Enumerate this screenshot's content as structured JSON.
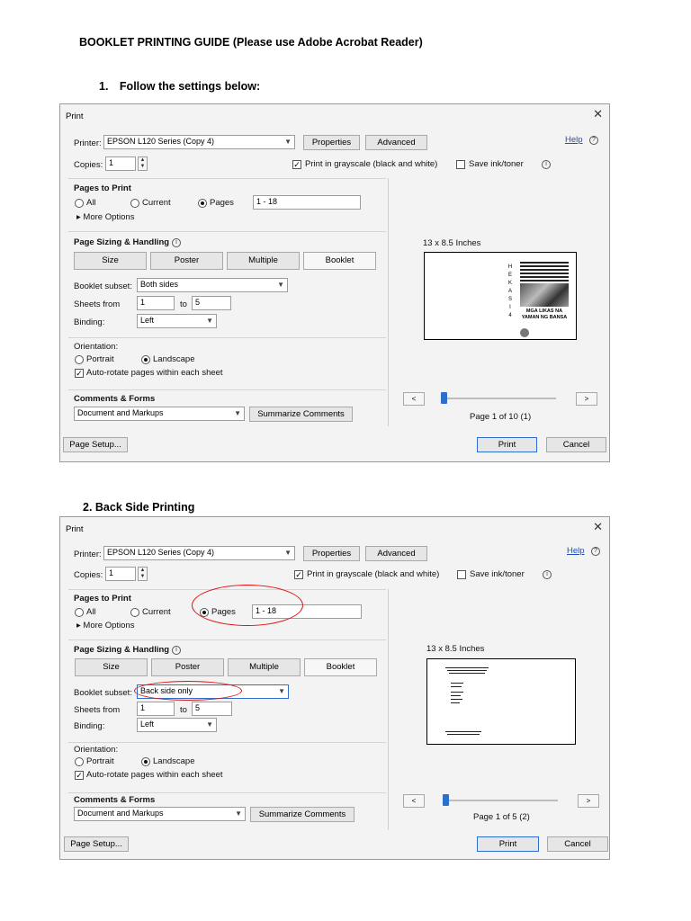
{
  "doc": {
    "title": "BOOKLET PRINTING GUIDE (Please use Adobe Acrobat Reader)",
    "step1": "1. Follow the settings below:",
    "step2": "2. Back Side Printing"
  },
  "dialogs": [
    {
      "title": "Print",
      "printer_label": "Printer:",
      "printer_value": "EPSON L120 Series (Copy 4)",
      "properties": "Properties",
      "advanced": "Advanced",
      "help": "Help",
      "copies_label": "Copies:",
      "copies_value": "1",
      "grayscale": "Print in grayscale (black and white)",
      "save_ink": "Save ink/toner",
      "pages_to_print": "Pages to Print",
      "all": "All",
      "current": "Current",
      "pages": "Pages",
      "pages_value": "1 - 18",
      "more_options": "More Options",
      "sizing": "Page Sizing & Handling",
      "size": "Size",
      "poster": "Poster",
      "multiple": "Multiple",
      "booklet": "Booklet",
      "booklet_subset_label": "Booklet subset:",
      "booklet_subset_value": "Both sides",
      "sheets_from_label": "Sheets from",
      "sheets_from_value": "1",
      "to_label": "to",
      "sheets_to_value": "5",
      "binding_label": "Binding:",
      "binding_value": "Left",
      "orientation": "Orientation:",
      "portrait": "Portrait",
      "landscape": "Landscape",
      "autorotate": "Auto-rotate pages within each sheet",
      "comments_forms": "Comments & Forms",
      "comments_value": "Document and Markups",
      "summarize": "Summarize Comments",
      "page_setup": "Page Setup...",
      "print": "Print",
      "cancel": "Cancel",
      "preview_size": "13 x 8.5 Inches",
      "page_of": "Page 1 of 10 (1)",
      "preview_left": "",
      "preview_right_vertical": "H E K A S I 4",
      "preview_cover": "MGA LIKAS NA YAMAN NG BANSA"
    },
    {
      "title": "Print",
      "printer_label": "Printer:",
      "printer_value": "EPSON L120 Series (Copy 4)",
      "properties": "Properties",
      "advanced": "Advanced",
      "help": "Help",
      "copies_label": "Copies:",
      "copies_value": "1",
      "grayscale": "Print in grayscale (black and white)",
      "save_ink": "Save ink/toner",
      "pages_to_print": "Pages to Print",
      "all": "All",
      "current": "Current",
      "pages": "Pages",
      "pages_value": "1 - 18",
      "more_options": "More Options",
      "sizing": "Page Sizing & Handling",
      "size": "Size",
      "poster": "Poster",
      "multiple": "Multiple",
      "booklet": "Booklet",
      "booklet_subset_label": "Booklet subset:",
      "booklet_subset_value": "Back side only",
      "sheets_from_label": "Sheets from",
      "sheets_from_value": "1",
      "to_label": "to",
      "sheets_to_value": "5",
      "binding_label": "Binding:",
      "binding_value": "Left",
      "orientation": "Orientation:",
      "portrait": "Portrait",
      "landscape": "Landscape",
      "autorotate": "Auto-rotate pages within each sheet",
      "comments_forms": "Comments & Forms",
      "comments_value": "Document and Markups",
      "summarize": "Summarize Comments",
      "page_setup": "Page Setup...",
      "print": "Print",
      "cancel": "Cancel",
      "preview_size": "13 x 8.5 Inches",
      "page_of": "Page 1 of 5 (2)"
    }
  ],
  "colors": {
    "accent": "#2f6fc9",
    "annotation": "#d11111",
    "link": "#1f4fbf"
  }
}
